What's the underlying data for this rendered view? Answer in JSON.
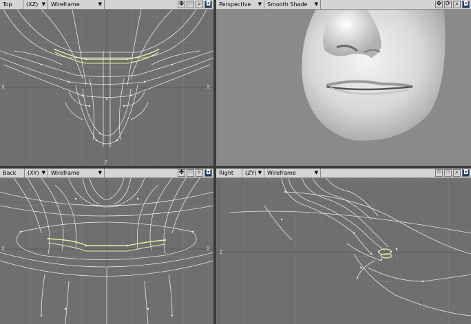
{
  "viewports": {
    "top": {
      "view": "Top",
      "axes": "(XZ)",
      "mode": "Wireframe"
    },
    "persp": {
      "view": "Perspective",
      "mode": "Smooth Shade"
    },
    "back": {
      "view": "Back",
      "axes": "(XY)",
      "mode": "Wireframe"
    },
    "right": {
      "view": "Right",
      "axes": "(ZY)",
      "mode": "Wireframe"
    }
  },
  "icons": {
    "move": "move-view-icon",
    "rotate": "rotate-view-icon",
    "zoom": "zoom-icon",
    "maximize": "maximize-viewport-icon"
  },
  "axis_marks": {
    "x": "X",
    "z": "Z",
    "y": "Y"
  },
  "colors": {
    "viewport_bg": "#6f6f6f",
    "grid": "#7c7c7c",
    "wire": "#e8e8e8",
    "selected": "#e6f0a0",
    "header_bg": "#d4d4d4"
  }
}
